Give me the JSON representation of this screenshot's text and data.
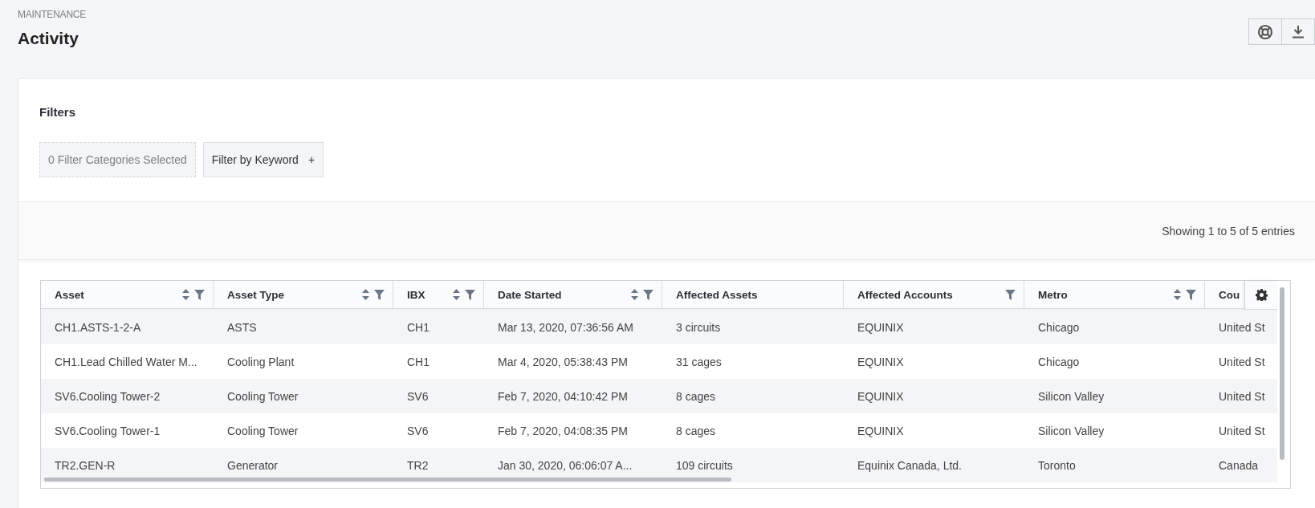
{
  "header": {
    "breadcrumb": "MAINTENANCE",
    "title": "Activity"
  },
  "filters": {
    "title": "Filters",
    "categories": "0 Filter Categories Selected",
    "keyword_button": "Filter by Keyword",
    "keyword_icon": "+"
  },
  "summary": "Showing 1 to 5 of 5 entries",
  "table": {
    "columns": [
      {
        "label": "Asset",
        "sortable": true,
        "filterable": true
      },
      {
        "label": "Asset Type",
        "sortable": true,
        "filterable": true
      },
      {
        "label": "IBX",
        "sortable": true,
        "filterable": true
      },
      {
        "label": "Date Started",
        "sortable": true,
        "filterable": true
      },
      {
        "label": "Affected Assets",
        "sortable": false,
        "filterable": false
      },
      {
        "label": "Affected Accounts",
        "sortable": false,
        "filterable": true
      },
      {
        "label": "Metro",
        "sortable": true,
        "filterable": true
      },
      {
        "label": "Cou",
        "sortable": false,
        "filterable": false
      }
    ],
    "rows": [
      [
        "CH1.ASTS-1-2-A",
        "ASTS",
        "CH1",
        "Mar 13, 2020, 07:36:56 AM",
        "3 circuits",
        "EQUINIX",
        "Chicago",
        "United St"
      ],
      [
        "CH1.Lead Chilled Water M...",
        "Cooling Plant",
        "CH1",
        "Mar 4, 2020, 05:38:43 PM",
        "31 cages",
        "EQUINIX",
        "Chicago",
        "United St"
      ],
      [
        "SV6.Cooling Tower-2",
        "Cooling Tower",
        "SV6",
        "Feb 7, 2020, 04:10:42 PM",
        "8 cages",
        "EQUINIX",
        "Silicon Valley",
        "United St"
      ],
      [
        "SV6.Cooling Tower-1",
        "Cooling Tower",
        "SV6",
        "Feb 7, 2020, 04:08:35 PM",
        "8 cages",
        "EQUINIX",
        "Silicon Valley",
        "United St"
      ],
      [
        "TR2.GEN-R",
        "Generator",
        "TR2",
        "Jan 30, 2020, 06:06:07 A...",
        "109 circuits",
        "Equinix Canada, Ltd.",
        "Toronto",
        "Canada"
      ]
    ]
  }
}
